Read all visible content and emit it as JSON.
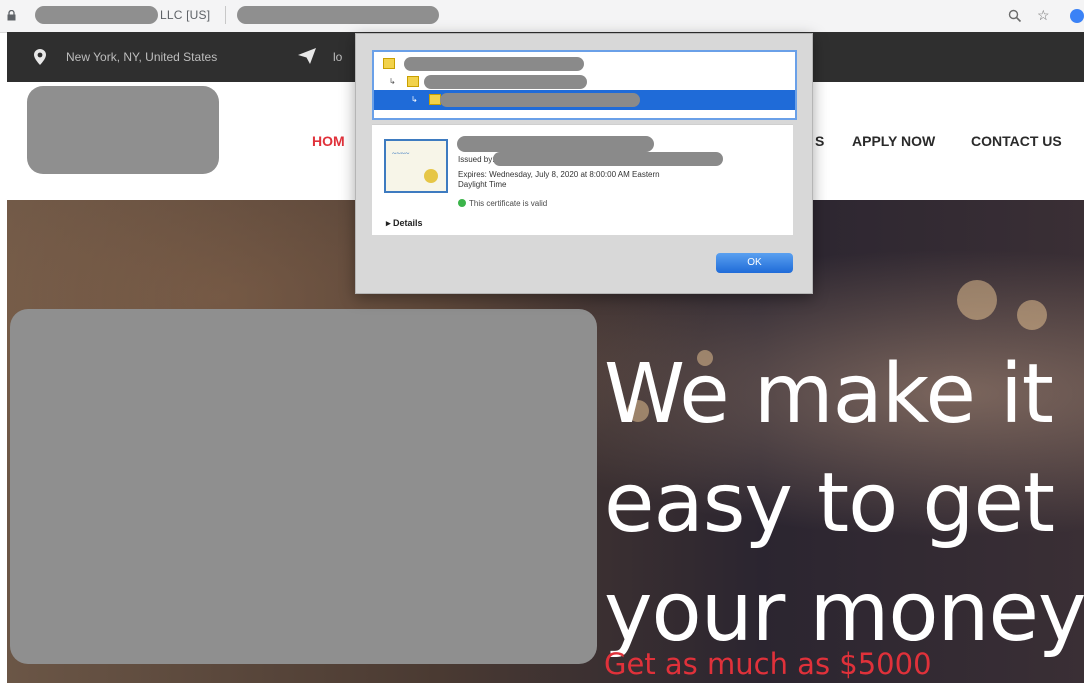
{
  "browser": {
    "org_label": "LLC [US]"
  },
  "top_bar": {
    "location": "New York, NY, United States",
    "email_partial": "lo"
  },
  "nav": {
    "home": "HOM",
    "services_partial": "S",
    "apply_now": "APPLY NOW",
    "contact_us": "CONTACT US"
  },
  "hero": {
    "headline_lines": [
      "We make it",
      "easy to get",
      "your money"
    ],
    "subline": "Get as much as $5000"
  },
  "cert_dialog": {
    "issued_by_label": "Issued by: G",
    "expires_line1": "Expires: Wednesday, July 8, 2020 at 8:00:00 AM Eastern",
    "expires_line2": "Daylight Time",
    "valid_text": "This certificate is valid",
    "details_label": "Details",
    "ok_label": "OK",
    "chain_arrow": "↳"
  },
  "colors": {
    "accent_red": "#e0313a",
    "dark_strip": "#2f2f2f",
    "dialog_blue": "#1f6bd8"
  }
}
